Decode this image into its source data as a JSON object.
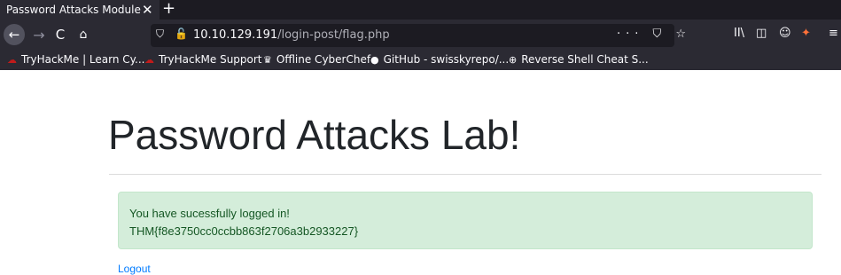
{
  "browser": {
    "tab": {
      "title": "Password Attacks Module",
      "close": "✕"
    },
    "new_tab": "+",
    "nav": {
      "back": "←",
      "forward": "→",
      "reload": "C",
      "home": "⌂"
    },
    "url": {
      "host": "10.10.129.191",
      "path": "/login-post/flag.php"
    },
    "url_actions": "··· ⛉ ☆",
    "toolbar": [
      "II\\",
      "◫",
      "☺",
      "✦",
      "≡"
    ],
    "bookmarks": [
      {
        "label": "TryHackMe | Learn Cy...",
        "icon": "thm-icon"
      },
      {
        "label": "TryHackMe Support",
        "icon": "thm-icon"
      },
      {
        "label": "Offline CyberChef",
        "icon": "chef-icon"
      },
      {
        "label": "GitHub - swisskyrepo/...",
        "icon": "github-icon"
      },
      {
        "label": "Reverse Shell Cheat S...",
        "icon": "globe-icon"
      }
    ]
  },
  "page": {
    "title": "Password Attacks Lab!",
    "alert_line1": "You have sucessfully logged in!",
    "alert_line2": "THM{f8e3750cc0ccbb863f2706a3b2933227}",
    "logout": "Logout"
  },
  "colors": {
    "alert_bg": "#d4edda",
    "alert_text": "#155724",
    "link": "#007bff",
    "chrome": "#2b2a33"
  }
}
